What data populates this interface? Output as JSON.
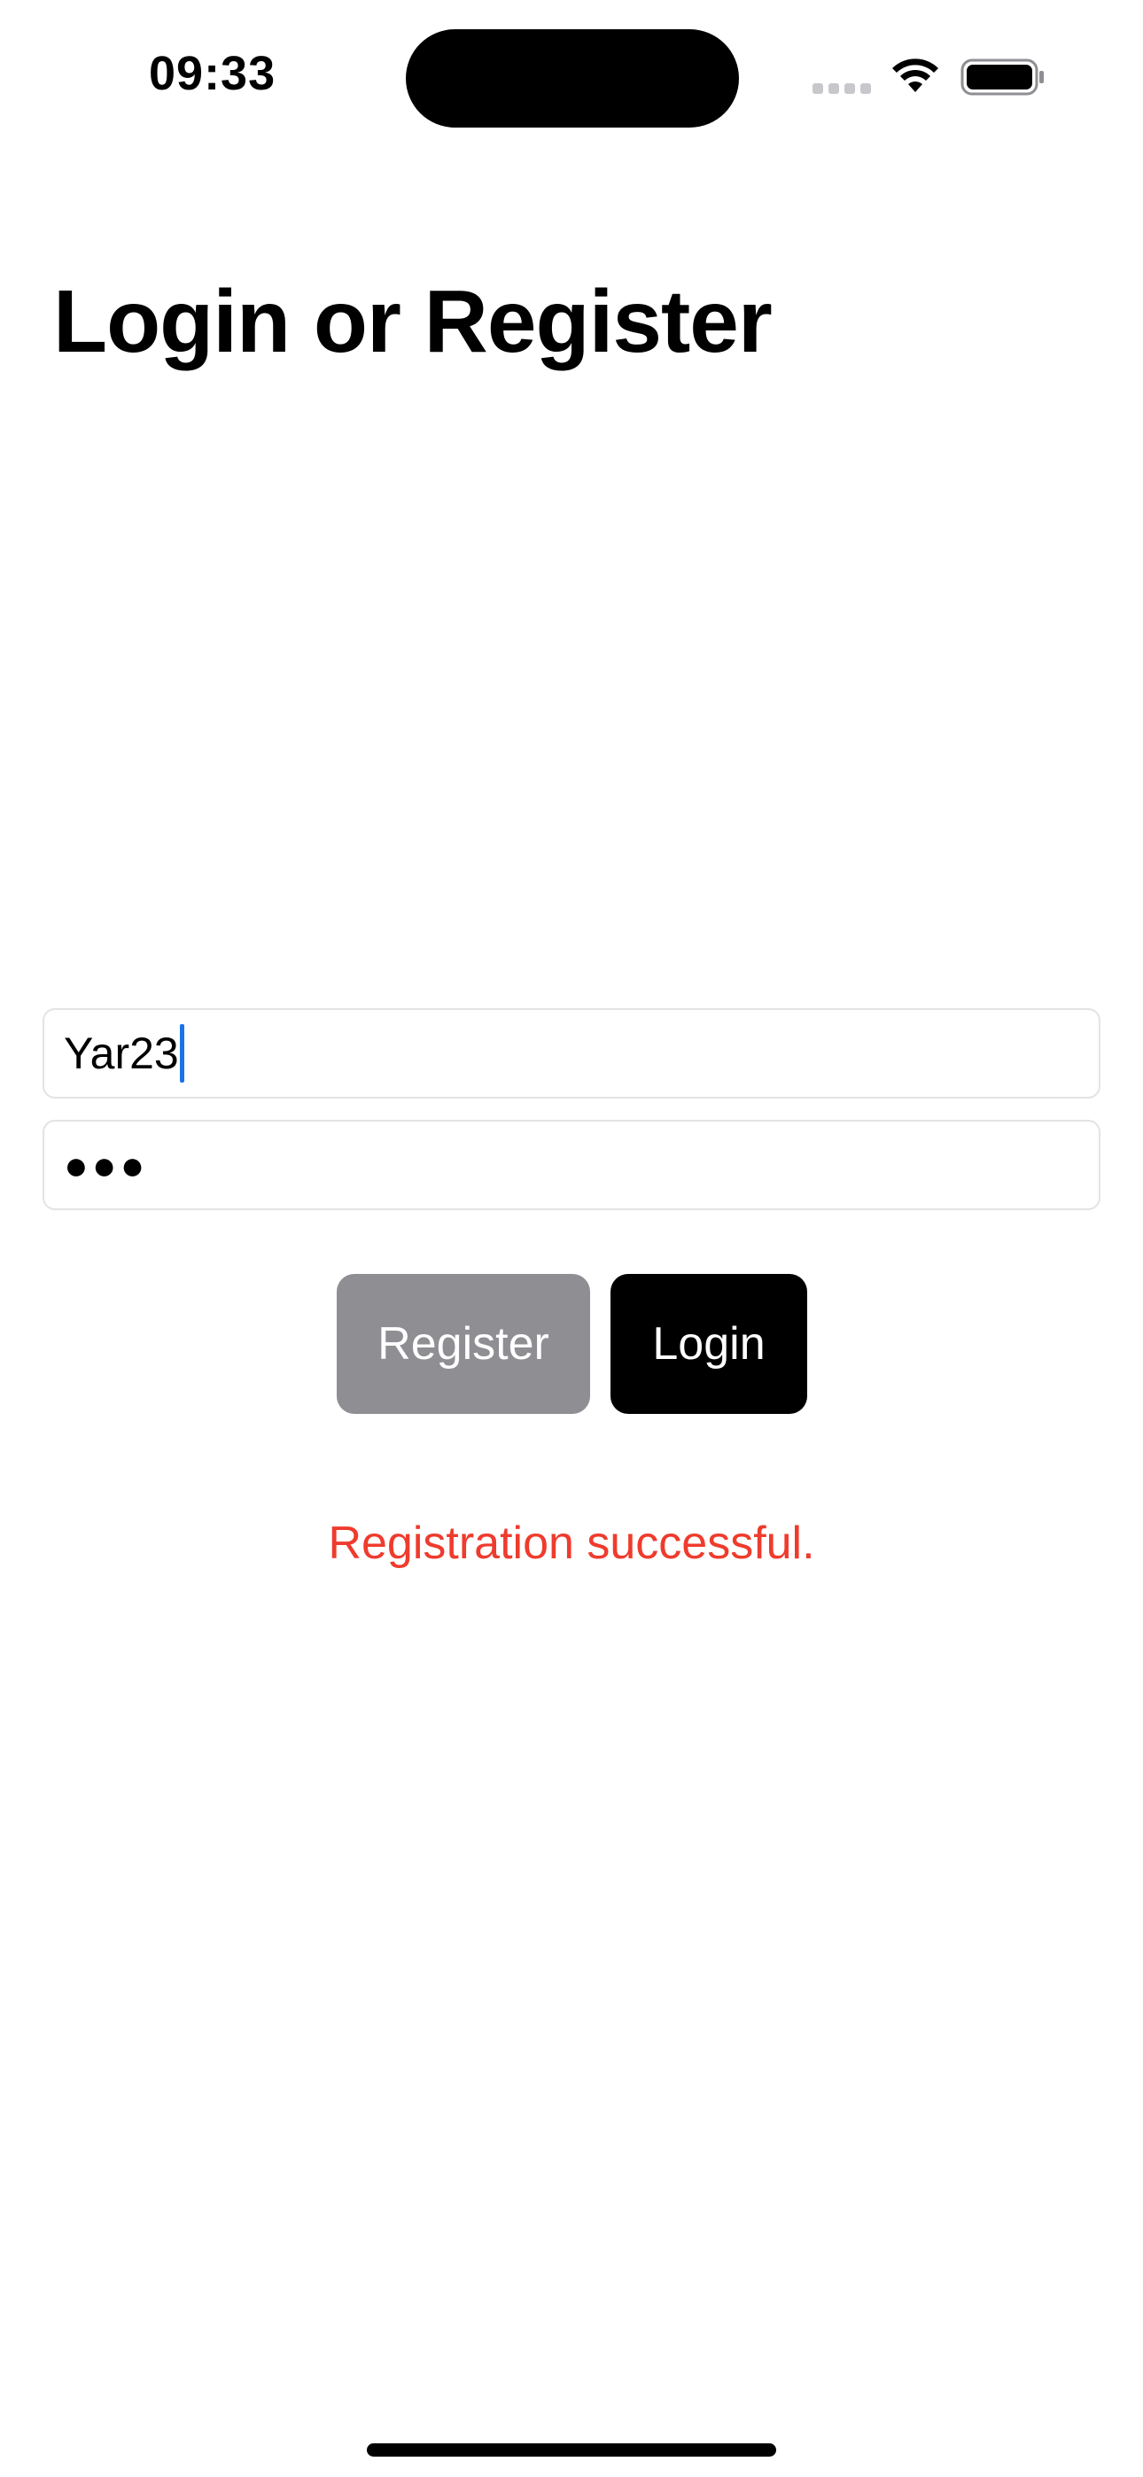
{
  "status_bar": {
    "time": "09:33",
    "icons": [
      "cellular-signal-icon",
      "wifi-icon",
      "battery-icon"
    ]
  },
  "page": {
    "title": "Login or Register"
  },
  "form": {
    "username_value": "Yar23",
    "password_masked": "●●●"
  },
  "buttons": {
    "register_label": "Register",
    "login_label": "Login"
  },
  "message": {
    "text": "Registration successful.",
    "color": "#ef3b2d"
  },
  "colors": {
    "register_button": "#8e8e93",
    "login_button": "#000000",
    "caret": "#1a73e8"
  }
}
